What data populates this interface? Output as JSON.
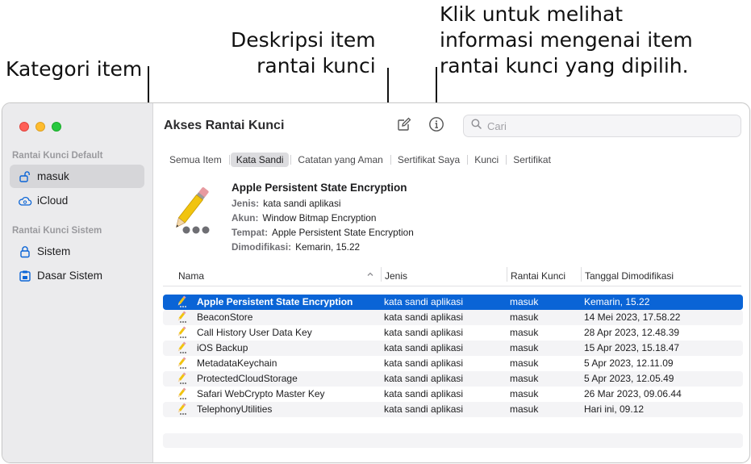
{
  "callouts": {
    "left": "Kategori item",
    "mid_line1": "Deskripsi item",
    "mid_line2": "rantai kunci",
    "right_line1": "Klik untuk melihat",
    "right_line2": "informasi mengenai item",
    "right_line3": "rantai kunci yang dipilih."
  },
  "window": {
    "title": "Akses Rantai Kunci",
    "search_placeholder": "Cari"
  },
  "sidebar": {
    "default_heading": "Rantai Kunci Default",
    "system_heading": "Rantai Kunci Sistem",
    "items": [
      {
        "label": "masuk",
        "icon": "unlocked-padlock-icon",
        "selected": true
      },
      {
        "label": "iCloud",
        "icon": "cloud-icon",
        "selected": false
      },
      {
        "label": "Sistem",
        "icon": "padlock-icon",
        "selected": false
      },
      {
        "label": "Dasar Sistem",
        "icon": "system-roots-icon",
        "selected": false
      }
    ]
  },
  "tabs": [
    {
      "label": "Semua Item",
      "active": false
    },
    {
      "label": "Kata Sandi",
      "active": true
    },
    {
      "label": "Catatan yang Aman",
      "active": false
    },
    {
      "label": "Sertifikat Saya",
      "active": false
    },
    {
      "label": "Kunci",
      "active": false
    },
    {
      "label": "Sertifikat",
      "active": false
    }
  ],
  "detail": {
    "title": "Apple Persistent State Encryption",
    "kind_label": "Jenis:",
    "kind_value": "kata sandi aplikasi",
    "account_label": "Akun:",
    "account_value": "Window Bitmap Encryption",
    "where_label": "Tempat:",
    "where_value": "Apple Persistent State Encryption",
    "modified_label": "Dimodifikasi:",
    "modified_value": "Kemarin, 15.22"
  },
  "table": {
    "headers": {
      "name": "Nama",
      "kind": "Jenis",
      "keychain": "Rantai Kunci",
      "modified": "Tanggal Dimodifikasi"
    },
    "sort_indicator": "chevron-up-icon",
    "rows": [
      {
        "name": "Apple Persistent State Encryption",
        "kind": "kata sandi aplikasi",
        "keychain": "masuk",
        "modified": "Kemarin, 15.22",
        "selected": true
      },
      {
        "name": "BeaconStore",
        "kind": "kata sandi aplikasi",
        "keychain": "masuk",
        "modified": "14 Mei 2023, 17.58.22",
        "selected": false
      },
      {
        "name": "Call History User Data Key",
        "kind": "kata sandi aplikasi",
        "keychain": "masuk",
        "modified": "28 Apr 2023, 12.48.39",
        "selected": false
      },
      {
        "name": "iOS Backup",
        "kind": "kata sandi aplikasi",
        "keychain": "masuk",
        "modified": "15 Apr 2023, 15.18.47",
        "selected": false
      },
      {
        "name": "MetadataKeychain",
        "kind": "kata sandi aplikasi",
        "keychain": "masuk",
        "modified": "5 Apr 2023, 12.11.09",
        "selected": false
      },
      {
        "name": "ProtectedCloudStorage",
        "kind": "kata sandi aplikasi",
        "keychain": "masuk",
        "modified": "5 Apr 2023, 12.05.49",
        "selected": false
      },
      {
        "name": "Safari WebCrypto Master Key",
        "kind": "kata sandi aplikasi",
        "keychain": "masuk",
        "modified": "26 Mar 2023, 09.06.44",
        "selected": false
      },
      {
        "name": "TelephonyUtilities",
        "kind": "kata sandi aplikasi",
        "keychain": "masuk",
        "modified": "Hari ini, 09.12",
        "selected": false
      }
    ]
  },
  "colors": {
    "selection": "#0a64d6",
    "sidebar_bg": "#ebebed",
    "accent": "#0a64d6"
  }
}
